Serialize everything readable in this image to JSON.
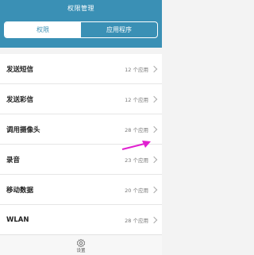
{
  "header": {
    "title": "权限管理"
  },
  "tabs": [
    {
      "label": "权限",
      "active": true
    },
    {
      "label": "应用程序",
      "active": false
    }
  ],
  "permissions": [
    {
      "name": "发送短信",
      "count": "12 个应用"
    },
    {
      "name": "发送彩信",
      "count": "12 个应用"
    },
    {
      "name": "调用摄像头",
      "count": "28 个应用"
    },
    {
      "name": "录音",
      "count": "23 个应用"
    },
    {
      "name": "移动数据",
      "count": "20 个应用"
    },
    {
      "name": "WLAN",
      "count": "28 个应用"
    }
  ],
  "bottom_bar": {
    "settings_label": "设置",
    "settings_icon": "gear-icon"
  },
  "colors": {
    "accent": "#3a90b5",
    "annotation": "#e020d0"
  }
}
